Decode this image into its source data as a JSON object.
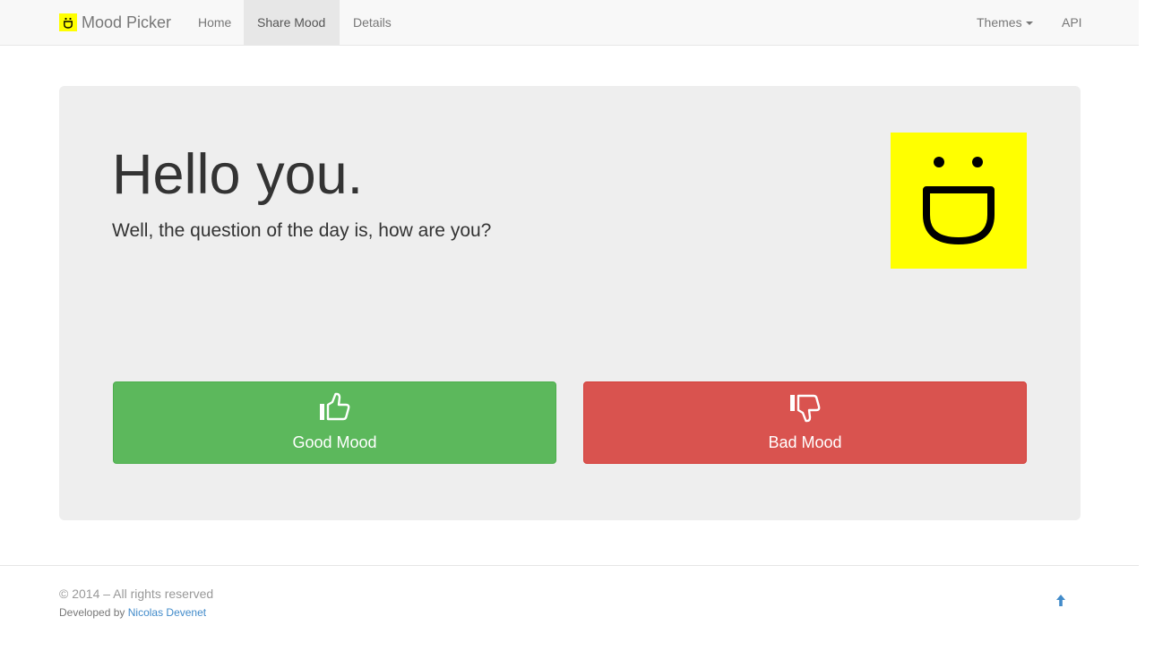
{
  "navbar": {
    "brand": "Mood Picker",
    "items": [
      {
        "label": "Home"
      },
      {
        "label": "Share Mood"
      },
      {
        "label": "Details"
      }
    ],
    "right_items": [
      {
        "label": "Themes"
      },
      {
        "label": "API"
      }
    ],
    "active_item": "Share Mood"
  },
  "hero": {
    "title": "Hello you.",
    "subtitle": "Well, the question of the day is, how are you?",
    "face_icon": "smiley-face-icon",
    "face_color": "#ffff00"
  },
  "buttons": {
    "good": {
      "label": "Good Mood",
      "icon": "thumbs-up-icon",
      "color": "#5cb85c"
    },
    "bad": {
      "label": "Bad Mood",
      "icon": "thumbs-down-icon",
      "color": "#d9534f"
    }
  },
  "footer": {
    "copyright": "© 2014 – All rights reserved",
    "developed_prefix": "Developed by",
    "developer": "Nicolas Devenet",
    "back_to_top_icon": "arrow-up-icon"
  }
}
